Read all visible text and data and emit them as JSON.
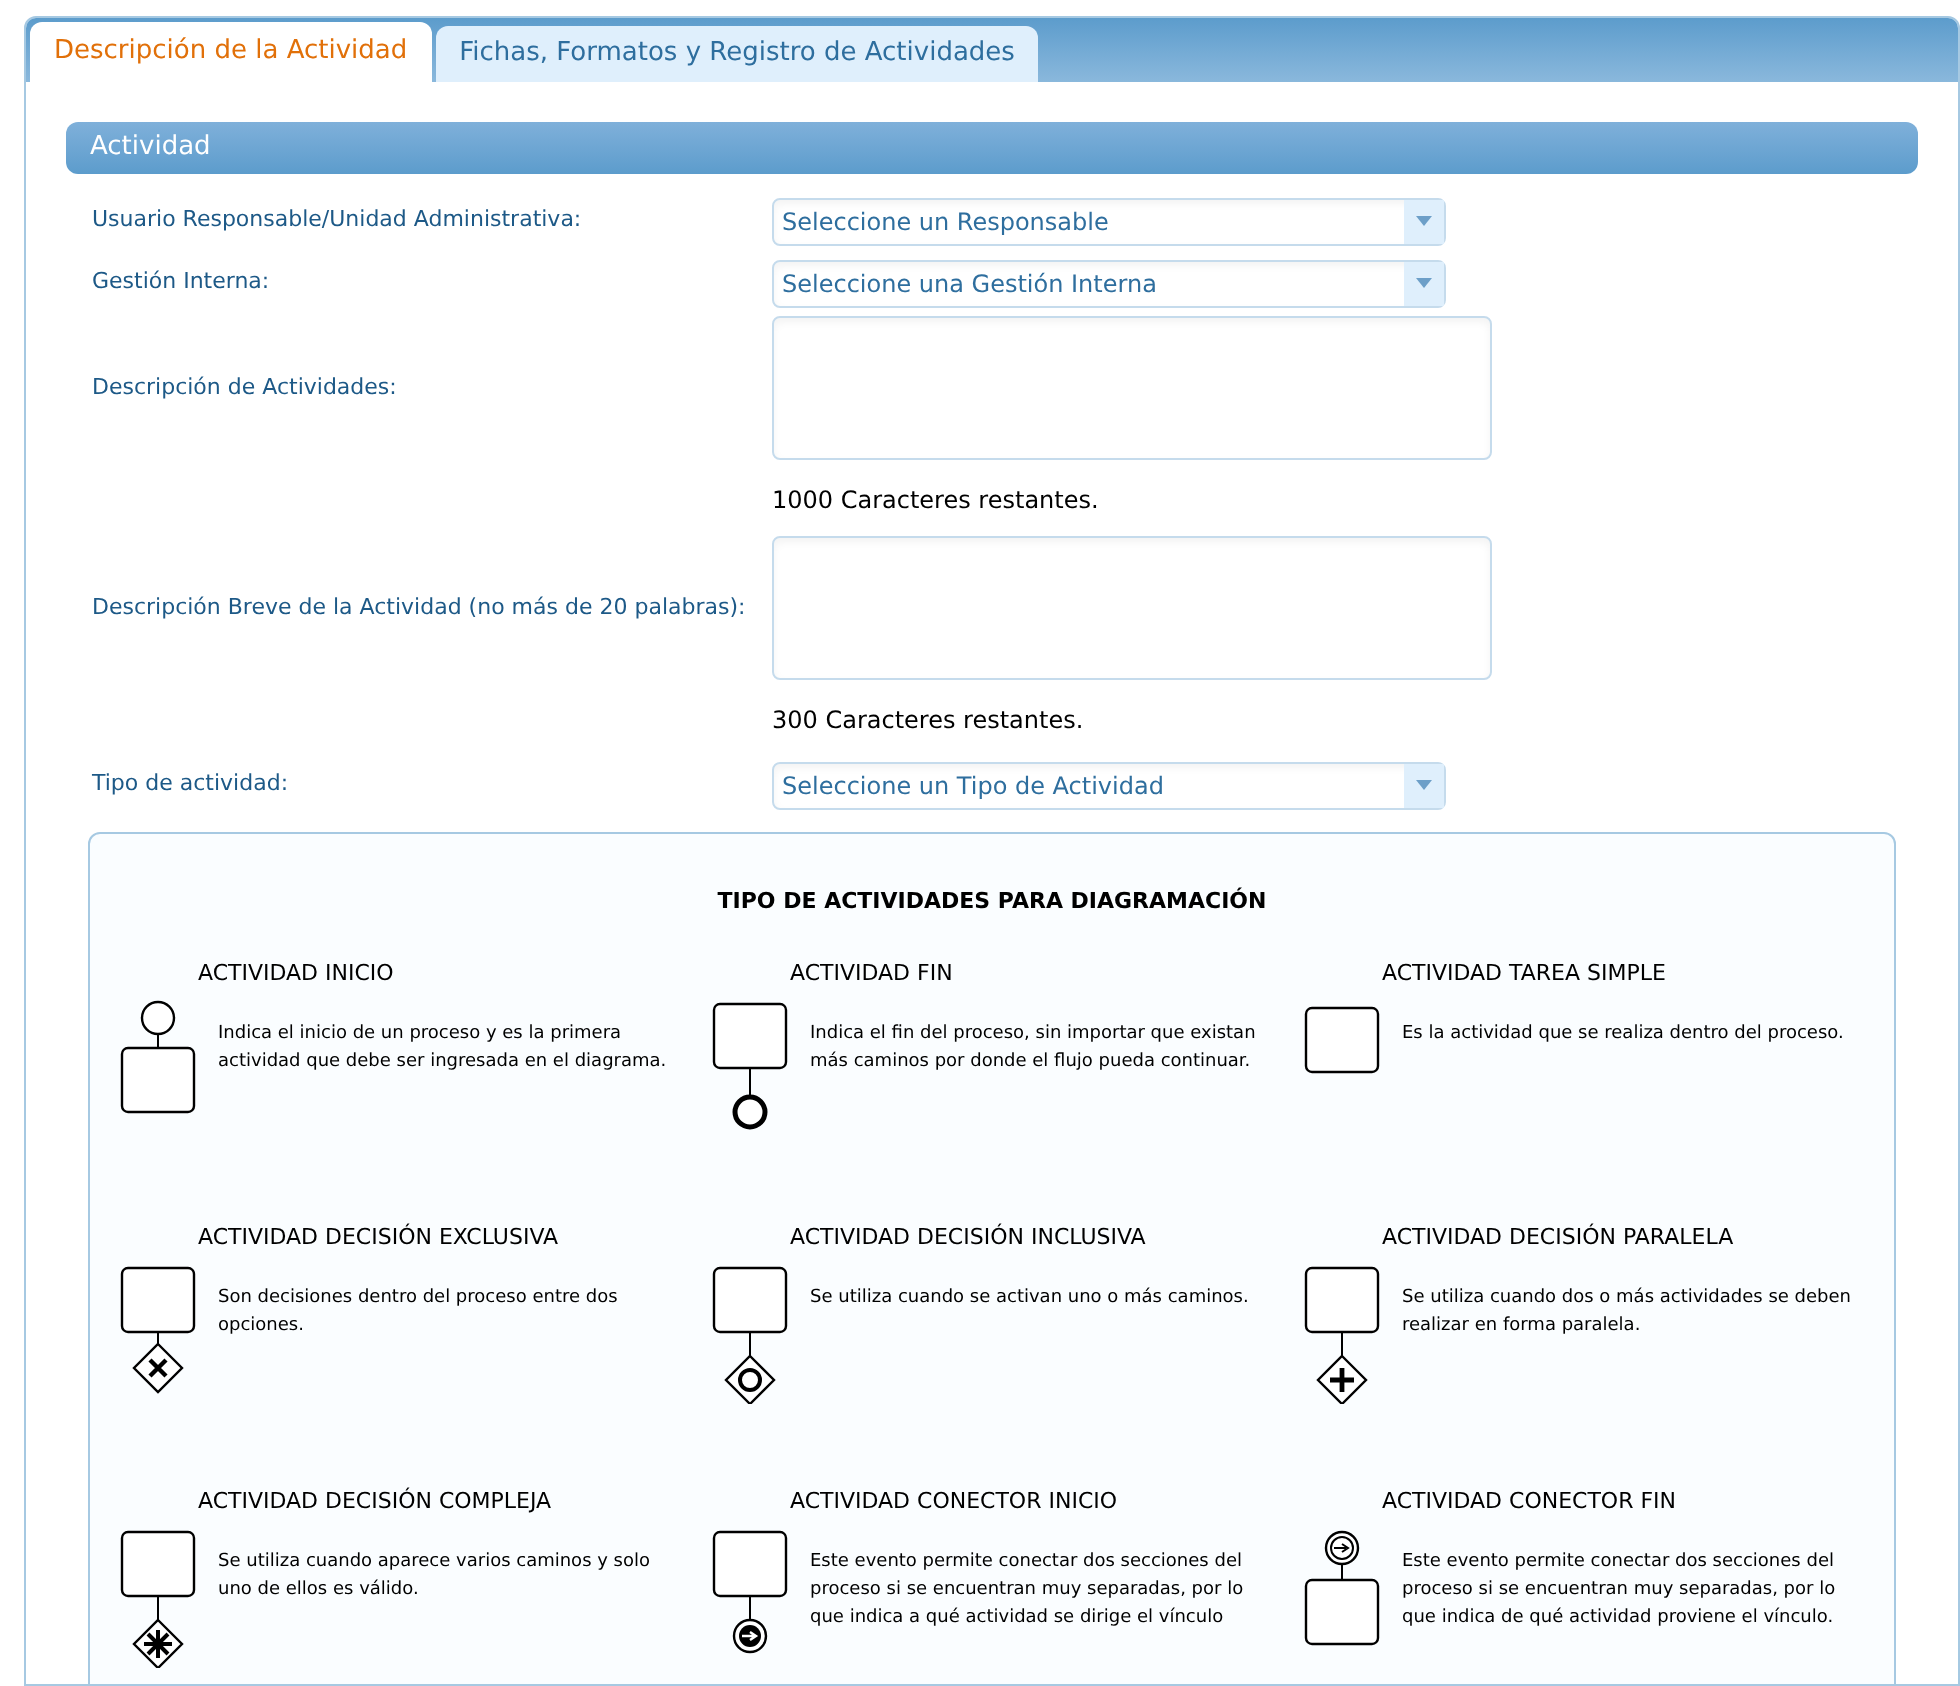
{
  "tabs": [
    {
      "label": "Descripción de la Actividad",
      "selected": true
    },
    {
      "label": "Fichas, Formatos y Registro de Actividades",
      "selected": false
    }
  ],
  "section": {
    "title": "Actividad"
  },
  "fields": [
    {
      "kind": "select",
      "label": "Usuario Responsable/Unidad Administrativa:",
      "placeholder": "Seleccione un Responsable"
    },
    {
      "kind": "select",
      "label": "Gestión Interna:",
      "placeholder": "Seleccione una Gestión Interna"
    },
    {
      "kind": "textarea",
      "label": "Descripción de Actividades:",
      "counter": "1000 Caracteres restantes."
    },
    {
      "kind": "textarea",
      "label": "Descripción Breve de la Actividad (no más de 20 palabras):",
      "counter": "300 Caracteres restantes."
    },
    {
      "kind": "select",
      "label": "Tipo de actividad:",
      "placeholder": "Seleccione un Tipo de Actividad"
    }
  ],
  "legend": {
    "title": "TIPO DE ACTIVIDADES PARA DIAGRAMACIÓN",
    "items": [
      {
        "kind": "start",
        "title": "ACTIVIDAD INICIO",
        "text": "Indica el inicio de un proceso y es la primera actividad que debe ser ingresada en el diagrama."
      },
      {
        "kind": "end",
        "title": "ACTIVIDAD FIN",
        "text": "Indica el fin del proceso, sin importar que existan más caminos por donde el flujo pueda continuar."
      },
      {
        "kind": "task",
        "title": "ACTIVIDAD TAREA SIMPLE",
        "text": "Es la actividad que se realiza dentro del proceso."
      },
      {
        "kind": "exclusive",
        "title": "ACTIVIDAD DECISIÓN EXCLUSIVA",
        "text": "Son decisiones dentro del proceso entre dos opciones."
      },
      {
        "kind": "inclusive",
        "title": "ACTIVIDAD DECISIÓN INCLUSIVA",
        "text": "Se utiliza cuando se activan uno o más caminos."
      },
      {
        "kind": "parallel",
        "title": "ACTIVIDAD DECISIÓN PARALELA",
        "text": "Se utiliza cuando dos o más actividades se deben realizar en forma paralela."
      },
      {
        "kind": "complex",
        "title": "ACTIVIDAD DECISIÓN COMPLEJA",
        "text": "Se utiliza cuando aparece varios caminos y solo uno de ellos es válido."
      },
      {
        "kind": "link_start",
        "title": "ACTIVIDAD CONECTOR INICIO",
        "text": "Este evento permite conectar dos secciones del proceso si se encuentran muy separadas, por lo que indica a qué actividad se dirige el vínculo"
      },
      {
        "kind": "link_end",
        "title": "ACTIVIDAD CONECTOR FIN",
        "text": "Este evento permite conectar dos secciones del proceso si se encuentran muy separadas, por lo que indica de qué actividad proviene el vínculo."
      }
    ]
  }
}
